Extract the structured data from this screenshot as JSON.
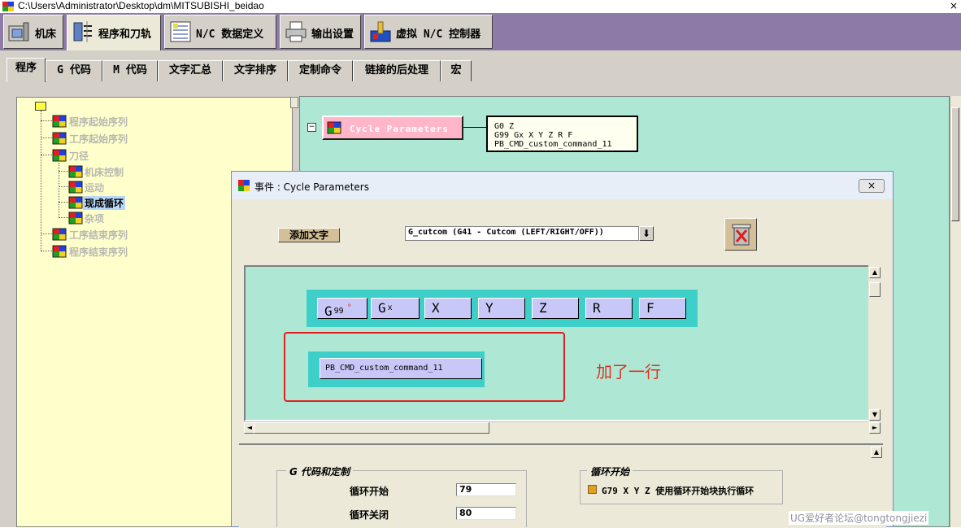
{
  "window": {
    "title": "C:\\Users\\Administrator\\Desktop\\dm\\MITSUBISHI_beidao",
    "close_glyph": "×"
  },
  "toolbar": [
    {
      "label": "机床",
      "icon": "machine-icon"
    },
    {
      "label": "程序和刀轨",
      "icon": "program-path-icon"
    },
    {
      "label": "N/C 数据定义",
      "icon": "data-definition-icon"
    },
    {
      "label": "输出设置",
      "icon": "printer-icon"
    },
    {
      "label": "虚拟 N/C 控制器",
      "icon": "virtual-controller-icon"
    }
  ],
  "tabs": [
    "程序",
    "G 代码",
    "M 代码",
    "文字汇总",
    "文字排序",
    "定制命令",
    "链接的后处理",
    "宏"
  ],
  "active_tab": "程序",
  "tree": {
    "items": [
      {
        "label": "程序起始序列"
      },
      {
        "label": "工序起始序列"
      },
      {
        "label": "刀径"
      },
      {
        "label": "机床控制"
      },
      {
        "label": "运动"
      },
      {
        "label": "现成循环",
        "selected": true
      },
      {
        "label": "杂项"
      },
      {
        "label": "工序结束序列"
      },
      {
        "label": "程序结束序列"
      }
    ]
  },
  "event_block": {
    "collapse_glyph": "−",
    "name": "Cycle Parameters",
    "code_lines": [
      "G0 Z",
      "G99 Gx X Y Z R F",
      "PB_CMD_custom_command_11"
    ]
  },
  "dialog": {
    "title": "事件 : Cycle Parameters",
    "close_glyph": "×",
    "add_text_label": "添加文字",
    "word_select_value": "G_cutcom (G41 - Cutcom (LEFT/RIGHT/OFF))",
    "dropdown_glyph": "⬇",
    "words": [
      {
        "main": "G",
        "sub": "99",
        "marker": "°"
      },
      {
        "main": "G",
        "sub": "x",
        "marker": ""
      },
      {
        "main": "X",
        "sub": "",
        "marker": ""
      },
      {
        "main": "Y",
        "sub": "",
        "marker": ""
      },
      {
        "main": "Z",
        "sub": "",
        "marker": ""
      },
      {
        "main": "R",
        "sub": "",
        "marker": ""
      },
      {
        "main": "F",
        "sub": "",
        "marker": ""
      }
    ],
    "custom_command": "PB_CMD_custom_command_11",
    "annotation": "加了一行",
    "g_group": {
      "title": "G 代码和定制",
      "rows": [
        {
          "label": "循环开始",
          "value": "79"
        },
        {
          "label": "循环关闭",
          "value": "80"
        }
      ]
    },
    "cycle_group": {
      "title": "循环开始",
      "checkbox_label": "G79 X Y Z  使用循环开始块执行循环",
      "checked": true
    }
  },
  "scroll_arrows": {
    "up": "▲",
    "down": "▼",
    "left": "◄",
    "right": "►"
  },
  "watermark": "UG爱好者论坛@tongtongjiezi"
}
